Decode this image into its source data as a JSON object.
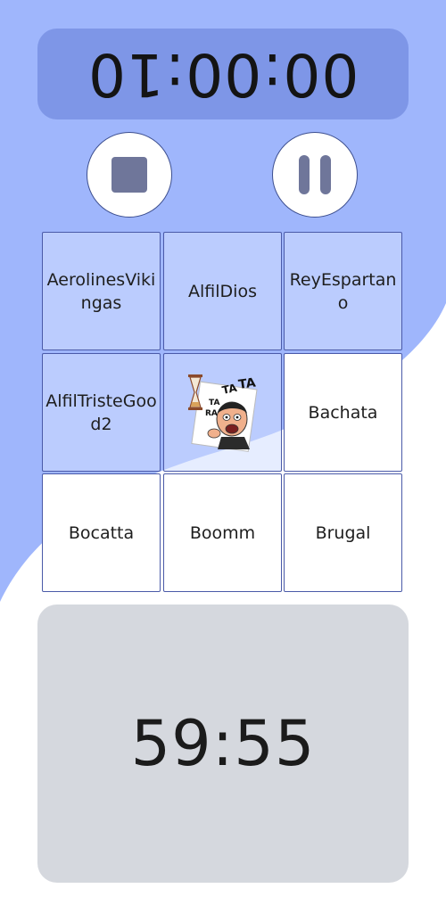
{
  "colors": {
    "background_blue": "#9fb6fc",
    "top_timer_panel": "#7e96e7",
    "bottom_timer_panel": "#d5d8de",
    "cell_border": "#4a5aa8",
    "button_icon": "#6f769a"
  },
  "opponent_timer": {
    "value": "00:00:10",
    "orientation": "upside-down"
  },
  "controls": {
    "stop_icon": "stop-icon",
    "pause_icon": "pause-icon"
  },
  "board": {
    "cells": [
      {
        "label": "AerolinesVikingas",
        "marked": true
      },
      {
        "label": "AlfilDios",
        "marked": true
      },
      {
        "label": "ReyEspartano",
        "marked": true
      },
      {
        "label": "AlfilTristeGood2",
        "marked": true
      },
      {
        "label": "",
        "icon": "screaming-cartoon-man-sticker-with-hourglass",
        "marked": true
      },
      {
        "label": "Bachata",
        "marked": false
      },
      {
        "label": "Bocatta",
        "marked": false
      },
      {
        "label": "Boomm",
        "marked": false
      },
      {
        "label": "Brugal",
        "marked": false
      }
    ]
  },
  "player_timer": {
    "value": "59:55"
  }
}
